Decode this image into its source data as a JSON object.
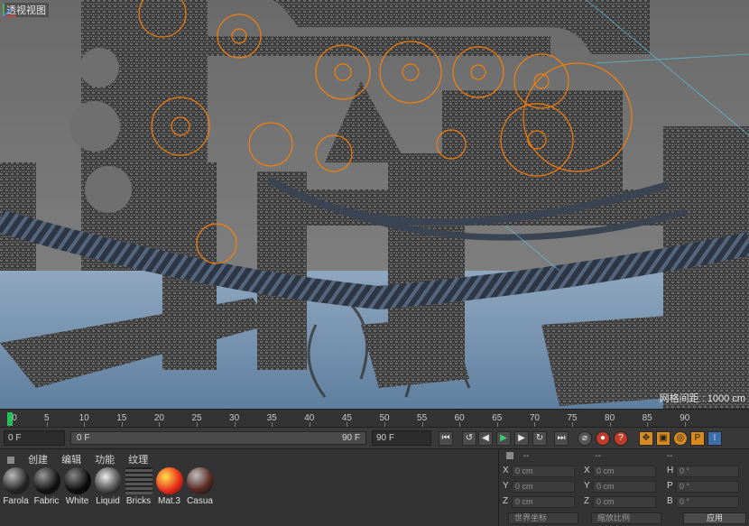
{
  "viewport": {
    "label": "透视视图",
    "grid_spacing": "网格间距 : 1000 cm"
  },
  "timeline": {
    "ticks": [
      "0",
      "5",
      "10",
      "15",
      "20",
      "25",
      "30",
      "35",
      "40",
      "45",
      "50",
      "55",
      "60",
      "65",
      "70",
      "75",
      "80",
      "85",
      "90"
    ],
    "current_frame": "0 F",
    "range_start": "0 F",
    "range_end": "90 F",
    "max_frame": "90 F",
    "end_frame": "0 F"
  },
  "material_manager": {
    "menu": [
      "创建",
      "编辑",
      "功能",
      "纹理"
    ],
    "materials": [
      {
        "label": "Farola"
      },
      {
        "label": "Fabric"
      },
      {
        "label": "White"
      },
      {
        "label": "Liquid"
      },
      {
        "label": "Bricks"
      },
      {
        "label": "Mat.3"
      },
      {
        "label": "Casua"
      }
    ]
  },
  "coordinates": {
    "col_headers": [
      "--",
      "--",
      "--"
    ],
    "rows": [
      {
        "a_label": "X",
        "a_val": "0 cm",
        "b_label": "X",
        "b_val": "0 cm",
        "c_label": "H",
        "c_val": "0 °"
      },
      {
        "a_label": "Y",
        "a_val": "0 cm",
        "b_label": "Y",
        "b_val": "0 cm",
        "c_label": "P",
        "c_val": "0 °"
      },
      {
        "a_label": "Z",
        "a_val": "0 cm",
        "b_label": "Z",
        "b_val": "0 cm",
        "c_label": "B",
        "c_val": "0 °"
      }
    ],
    "world_coords": "世界坐标",
    "scale_mode": "缩放比例",
    "apply_label": "应用"
  },
  "colors": {
    "accent_orange": "#ff7f00",
    "playhead_green": "#25c25b"
  }
}
